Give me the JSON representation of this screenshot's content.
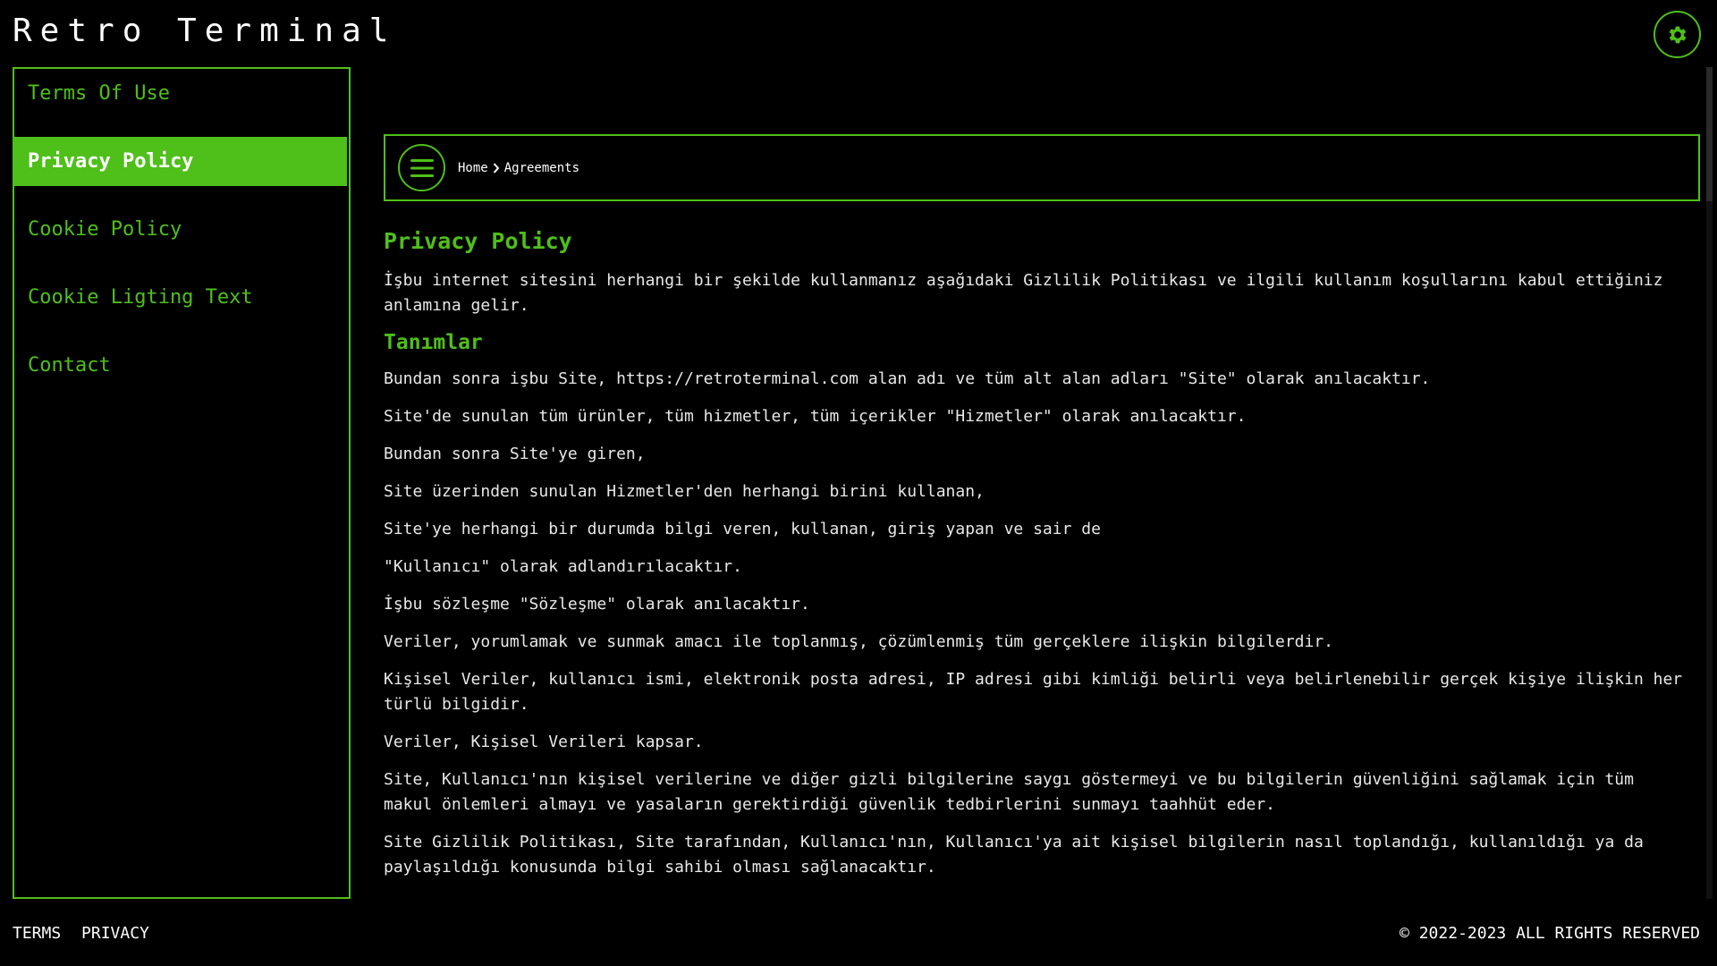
{
  "app": {
    "title": "Retro Terminal"
  },
  "header": {
    "settings_icon": "gear-icon"
  },
  "colors": {
    "accent": "#4fbf1a",
    "background": "#000000",
    "text": "#e8e8e8"
  },
  "sidebar": {
    "items": [
      {
        "label": "Terms Of Use",
        "active": false
      },
      {
        "label": "Privacy Policy",
        "active": true
      },
      {
        "label": "Cookie Policy",
        "active": false
      },
      {
        "label": "Cookie Ligting Text",
        "active": false
      },
      {
        "label": "Contact",
        "active": false
      }
    ]
  },
  "breadcrumb": {
    "home": "Home",
    "current": "Agreements",
    "menu_icon": "hamburger-menu-icon"
  },
  "content": {
    "title": "Privacy Policy",
    "intro": "İşbu internet sitesini herhangi bir şekilde kullanmanız aşağıdaki Gizlilik Politikası ve ilgili kullanım koşullarını kabul ettiğiniz anlamına gelir.",
    "section_title": "Tanımlar",
    "paragraphs": [
      "Bundan sonra işbu Site, https://retroterminal.com alan adı ve tüm alt alan adları \"Site\" olarak anılacaktır.",
      "Site'de sunulan tüm ürünler, tüm hizmetler, tüm içerikler \"Hizmetler\" olarak anılacaktır.",
      "Bundan sonra Site'ye giren,",
      "Site üzerinden sunulan Hizmetler'den herhangi birini kullanan,",
      "Site'ye herhangi bir durumda bilgi veren, kullanan, giriş yapan ve sair de",
      "\"Kullanıcı\" olarak adlandırılacaktır.",
      "İşbu sözleşme \"Sözleşme\" olarak anılacaktır.",
      "Veriler, yorumlamak ve sunmak amacı ile toplanmış, çözümlenmiş tüm gerçeklere ilişkin bilgilerdir.",
      "Kişisel Veriler, kullanıcı ismi, elektronik posta adresi, IP adresi gibi kimliği belirli veya belirlenebilir gerçek kişiye ilişkin her türlü bilgidir.",
      "Veriler, Kişisel Verileri kapsar.",
      "Site, Kullanıcı'nın kişisel verilerine ve diğer gizli bilgilerine saygı göstermeyi ve bu bilgilerin güvenliğini sağlamak için tüm makul önlemleri almayı ve yasaların gerektirdiği güvenlik tedbirlerini sunmayı taahhüt eder.",
      "Site Gizlilik Politikası, Site tarafından, Kullanıcı'nın, Kullanıcı'ya ait kişisel bilgilerin nasıl toplandığı, kullanıldığı ya da paylaşıldığı konusunda bilgi sahibi olması sağlanacaktır."
    ]
  },
  "footer": {
    "links": [
      "TERMS",
      "PRIVACY"
    ],
    "copyright": "© 2022-2023 ALL RIGHTS RESERVED"
  }
}
